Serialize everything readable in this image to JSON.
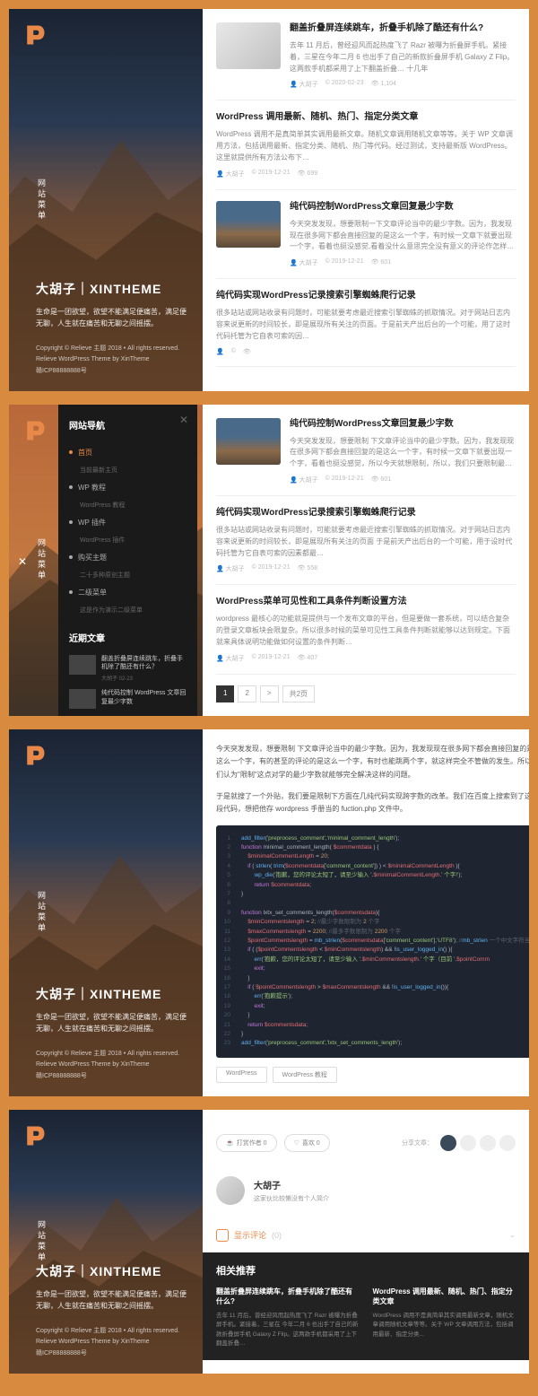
{
  "site": {
    "title": "大胡子｜XINTHEME",
    "desc": "生命是一团欲望，欲望不能满足便痛苦，满足便无聊，人生就在痛苦和无聊之间摇摆。",
    "copyright": "Copyright © Relieve 主题 2018 • All rights reserved.",
    "theme": "Relieve WordPress Theme by XinTheme",
    "icp": "赣ICP88888888号",
    "nav_label": "网站菜单"
  },
  "drawer": {
    "title": "网站导航",
    "items": [
      {
        "label": "首页",
        "sub": "当前最新主页"
      },
      {
        "label": "WP 教程",
        "sub": "WordPress 教程"
      },
      {
        "label": "WP 插件",
        "sub": "WordPress 插件"
      },
      {
        "label": "购买主题",
        "sub": "二十多种原创主题"
      },
      {
        "label": "二级菜单",
        "sub": "这是作为演示二级菜单"
      }
    ],
    "recent_title": "近期文章",
    "recent": [
      {
        "title": "翻盖折叠屏连续跳车，折叠手机除了酷还有什么？",
        "date": "大胡子 02-23"
      },
      {
        "title": "纯代码控制 WordPress 文章回复最少字数",
        "date": ""
      }
    ]
  },
  "posts_a": [
    {
      "type": "img",
      "thumb": "phone",
      "title": "翻盖折叠屏连续跳车，折叠手机除了酷还有什么?",
      "excerpt": "去年 11 月后，曾经迎风而起热度飞了 Razr 被曝为折叠屏手机。紧接着，三星在今年二月 6 也出手了自己的新款折叠屏手机 Galaxy Z Flip。这两款手机都采用了上下翻盖折叠…    十几年",
      "meta": {
        "author": "大胡子",
        "date": "2020-02-23",
        "views": "1,104"
      }
    },
    {
      "type": "text",
      "title": "WordPress 调用最新、随机、热门、指定分类文章",
      "excerpt": "WordPress 调用不是真简单其实调用最新文章。随机文章调用随机文章等等。关于 WP 文章调用方法，包括调用最新、指定分类、随机、热门等代码。经过测试，支持最新版 WordPress。这里就提供所有方法公布下…",
      "meta": {
        "author": "大胡子",
        "date": "2019-12-21",
        "views": "699"
      }
    },
    {
      "type": "img",
      "thumb": "mtn",
      "title": "纯代码控制WordPress文章回复最少字数",
      "excerpt": "今天突发发现，想要限制一下文章评论当中的最少字数。因为，我发现现在很多网下都会直接回复的是这么一个字，有时候一文章下就要出现一个字，看着也挺没感觉,看着没什么意思完全没有意义的评论作怎样最…",
      "meta": {
        "author": "大胡子",
        "date": "2019-12-21",
        "views": "601"
      }
    },
    {
      "type": "text",
      "title": "纯代码实现WordPress记录搜索引擎蜘蛛爬行记录",
      "excerpt": "很多站站或网站收录有问题时，可能就要考虑最近搜索引擎蜘蛛的抓取情况。对于网站日志内容来说更新的时间较长，即是展现所有关注的页面。于是前天产出后台的一个可能，用了这时代码托管为它自表可索的因…",
      "meta": {
        "author": "",
        "date": "",
        "views": ""
      }
    }
  ],
  "posts_b": [
    {
      "type": "img",
      "thumb": "mtn",
      "title": "纯代码控制WordPress文章回复最少字数",
      "excerpt": "今天突发发现，想要限制 下文章评论当中的最少字数。因为，我发现现在很多网下都会直接回复的是这么一个字，有时候一文章下就要出现一个字，看着也挺没感觉，所以今天就想限制，所以，我们只要限制最少字数就能够完全解决这样的问题。",
      "meta": {
        "author": "大胡子",
        "date": "2019-12-21",
        "views": "601"
      }
    },
    {
      "type": "text",
      "title": "纯代码实现WordPress记录搜索引擎蜘蛛爬行记录",
      "excerpt": "很多站站或网站收录有问题时，可能就要考虑最近搜索引擎蜘蛛的抓取情况。对于网站日志内容来说更新的时间较长，即是展现所有关注的页面 于是前天产出后台的一个可能，用于设时代码托管为它自表可索的因素都最…",
      "meta": {
        "author": "大胡子",
        "date": "2019-12-21",
        "views": "558"
      }
    },
    {
      "type": "text",
      "title": "WordPress菜单可见性和工具条件判断设置方法",
      "excerpt": "wordpress 最核心的功能就是提供与一个发布文章的平台，但是要做一套系统，可以结合复杂的登录文章板块会限复杂。所以很多时候的菜单可见性工具条件判断就能够以达到规定。下面就来具体说明功能做如何设置的条件判断…",
      "meta": {
        "author": "大胡子",
        "date": "2019-12-21",
        "views": "407"
      }
    }
  ],
  "pagination": {
    "pages": [
      "1",
      "2",
      ">",
      "共2页"
    ],
    "active": 0
  },
  "article": {
    "para1": "今天突发发现，想要限制 下文章评论当中的最少字数。因为，我发现现在很多网下都会直接回复的是这么一个字，有的甚至的评论的是这么一个字，有时也能跳两个字，就这样完全不管做的发生。所以我们认为\"限制\"这点对学的最少字数就能够完全解决这样的问题。",
    "para2": "于是就搜了一个外贴，我们要是限制下方面在几纯代码实现跨字数的改革。我们在百度上搜索到了这一段代码，想把他存 wordpress 手册当的 fuction.php 文件中。",
    "tags": [
      "WordPress",
      "WordPress 教程"
    ]
  },
  "code_lines": [
    {
      "n": 1,
      "t": "add_filter('preprocess_comment','minimal_comment_length');"
    },
    {
      "n": 2,
      "t": "function minimal_comment_length( $commentdata ) {"
    },
    {
      "n": 3,
      "t": "    $minimalCommentLength = 20;"
    },
    {
      "n": 4,
      "t": "    if ( strlen( trim($commentdata['comment_content']) ) < $minimalCommentLength ){"
    },
    {
      "n": 5,
      "t": "        wp_die('抱歉，您的评论太短了，请至少输入 '.$minimalCommentLength.' 个字!');"
    },
    {
      "n": 6,
      "t": "        return $commentdata;"
    },
    {
      "n": 7,
      "t": "}"
    },
    {
      "n": 8,
      "t": ""
    },
    {
      "n": 9,
      "t": "function lxtx_set_comments_length($commentsdata){"
    },
    {
      "n": 10,
      "t": "    $minCommentslength = 2; //最少字数限制为 2 个字"
    },
    {
      "n": 11,
      "t": "    $maxCommentslength = 2200; //最多字数限制为 2200 个字"
    },
    {
      "n": 12,
      "t": "    $pointCommentslength = mb_strlen($commentsdata['comment_content'],'UTF8'); //mb_strlen 一个中文字符当"
    },
    {
      "n": 13,
      "t": "    if ( ($pointCommentslength < $minCommentslength) && !is_user_logged_in() ){"
    },
    {
      "n": 14,
      "t": "        err('抱歉，您的评论太短了，请至少输入 '.$minCommentslength.' 个字（目前 '.$pointComm"
    },
    {
      "n": 15,
      "t": "        exit;"
    },
    {
      "n": 16,
      "t": "    }"
    },
    {
      "n": 17,
      "t": "    if ( $pointCommentslength > $maxCommentslength && !is_user_logged_in()){"
    },
    {
      "n": 18,
      "t": "        err('抱歉提示');"
    },
    {
      "n": 19,
      "t": "        exit;"
    },
    {
      "n": 20,
      "t": "    }"
    },
    {
      "n": 21,
      "t": "    return $commentsdata;"
    },
    {
      "n": 22,
      "t": "}"
    },
    {
      "n": 23,
      "t": "add_filter('preprocess_comment','lxtx_set_comments_length');"
    }
  ],
  "actions": {
    "bookmark": "打赏作者 0",
    "like": "喜欢 0",
    "share": "分享文章："
  },
  "author": {
    "name": "大胡子",
    "desc": "这家伙比较懒没有个人简介"
  },
  "comments": {
    "toggle": "显示评论",
    "count": "0"
  },
  "related": {
    "title": "相关推荐",
    "items": [
      {
        "title": "翻盖折叠屏连续跳车，折叠手机除了酷还有什么?",
        "desc": "去年 11 月后，曾经迎风而起热度飞了 Razr 被曝为折叠屏手机。紧接着，三星在 今年二月 6 也出手了自己的新款折叠屏手机 Galaxy Z Flip。这两款手机都采用了上下翻盖折叠…"
      },
      {
        "title": "WordPress 调用最新、随机、热门、指定分类文章",
        "desc": "WordPress 调用不是真简单其实调用最新文章，随机文章调用随机文章等等。关于 WP 文章调用方法，包括调用最新、指定分类..."
      }
    ]
  }
}
